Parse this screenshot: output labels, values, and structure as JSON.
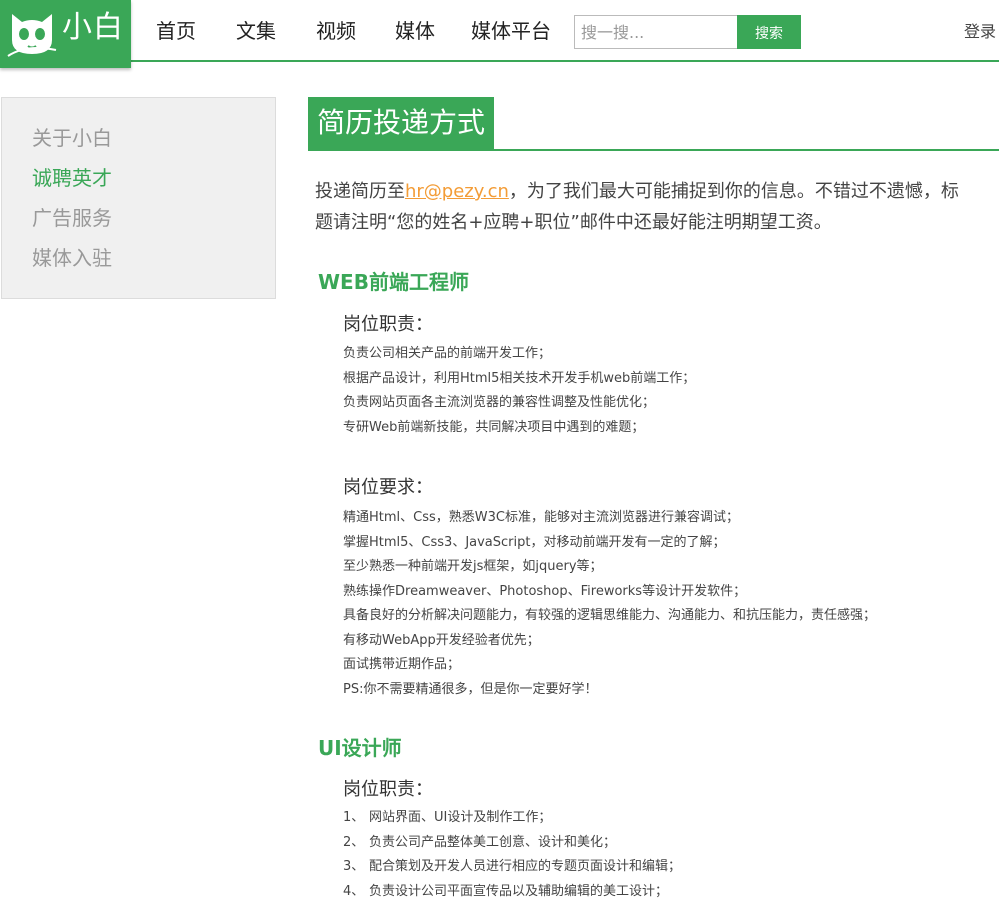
{
  "header": {
    "logo_text": "小白",
    "nav": [
      "首页",
      "文集",
      "视频",
      "媒体",
      "媒体平台"
    ],
    "search": {
      "placeholder": "搜一搜...",
      "button_label": "搜索"
    },
    "login_label": "登录"
  },
  "sidebar": {
    "items": [
      {
        "label": "关于小白",
        "active": false
      },
      {
        "label": "诚聘英才",
        "active": true
      },
      {
        "label": "广告服务",
        "active": false
      },
      {
        "label": "媒体入驻",
        "active": false
      }
    ]
  },
  "main": {
    "title": "简历投递方式",
    "intro": {
      "before_email": "投递简历至",
      "email": "hr@pezy.cn",
      "after_email": "，为了我们最大可能捕捉到你的信息。不错过不遗憾，标题请注明“您的姓名+应聘+职位”邮件中还最好能注明期望工资。"
    },
    "jobs": [
      {
        "title": "WEB前端工程师",
        "duties_label": "岗位职责：",
        "duties": [
          "负责公司相关产品的前端开发工作；",
          "根据产品设计，利用Html5相关技术开发手机web前端工作；",
          "负责网站页面各主流浏览器的兼容性调整及性能优化；",
          "专研Web前端新技能，共同解决项目中遇到的难题；"
        ],
        "requirements_label": "岗位要求：",
        "requirements": [
          "精通Html、Css，熟悉W3C标准，能够对主流浏览器进行兼容调试；",
          "掌握Html5、Css3、JavaScript，对移动前端开发有一定的了解；",
          "至少熟悉一种前端开发js框架，如jquery等；",
          "熟练操作Dreamweaver、Photoshop、Fireworks等设计开发软件；",
          "具备良好的分析解决问题能力，有较强的逻辑思维能力、沟通能力、和抗压能力，责任感强；",
          "有移动WebApp开发经验者优先；",
          "面试携带近期作品；",
          "PS:你不需要精通很多，但是你一定要好学！"
        ]
      },
      {
        "title": "UI设计师",
        "duties_label": "岗位职责：",
        "duties": [
          {
            "num": "1、",
            "text": "网站界面、UI设计及制作工作；"
          },
          {
            "num": "2、",
            "text": "负责公司产品整体美工创意、设计和美化；"
          },
          {
            "num": "3、",
            "text": "配合策划及开发人员进行相应的专题页面设计和编辑；"
          },
          {
            "num": "4、",
            "text": "负责设计公司平面宣传品以及辅助编辑的美工设计；"
          }
        ]
      }
    ]
  },
  "colors": {
    "accent": "#3aa757",
    "link": "#f39c36",
    "muted": "#999999"
  }
}
